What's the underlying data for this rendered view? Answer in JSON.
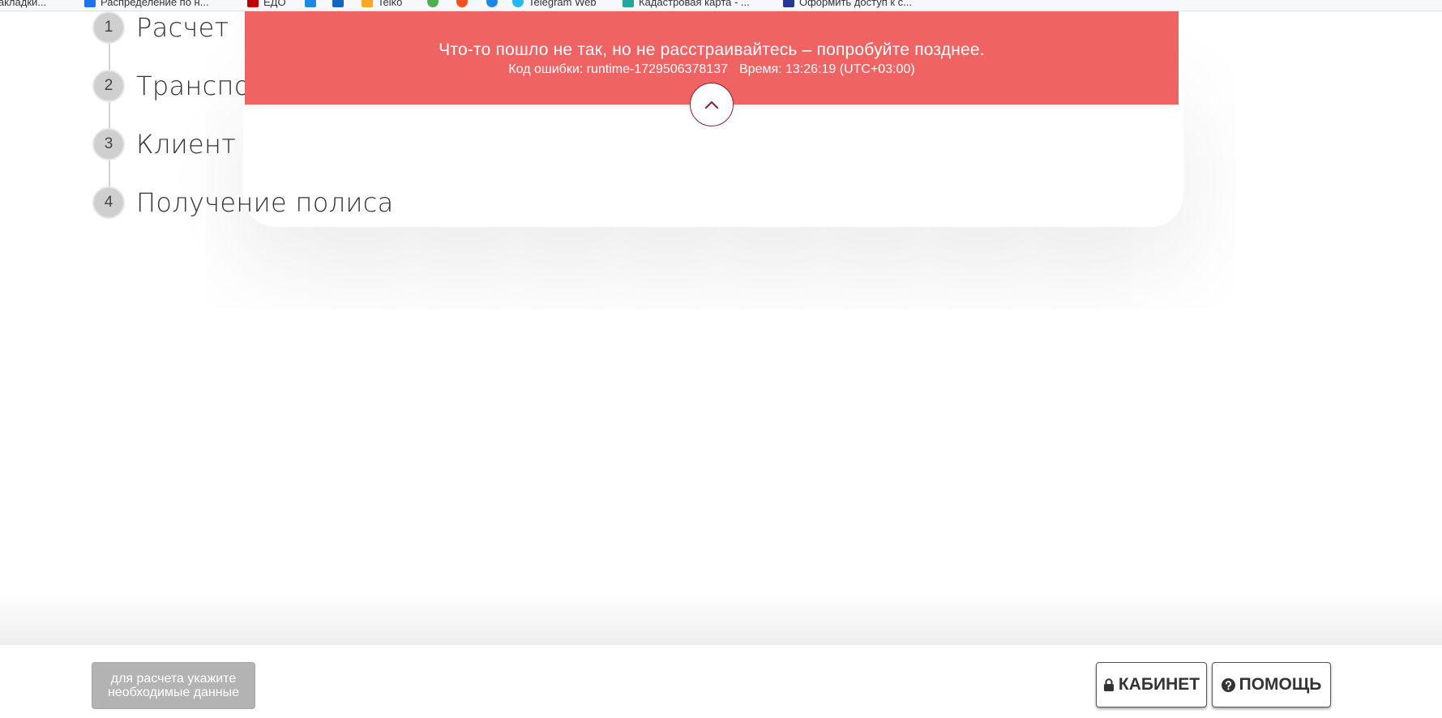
{
  "bookmarks": [
    {
      "label": "Закладки...",
      "color": "#1a73e8"
    },
    {
      "label": "Распределение по н...",
      "color": "#1a73e8"
    },
    {
      "label": "ЕДО",
      "color": "#c00000"
    },
    {
      "label": "",
      "color": "#1e88e5"
    },
    {
      "label": "",
      "color": "#1565c0"
    },
    {
      "label": "Telko",
      "color": "#f9a825"
    },
    {
      "label": "",
      "color": "#4caf50"
    },
    {
      "label": "",
      "color": "#f4511e"
    },
    {
      "label": "",
      "color": "#1e88e5"
    },
    {
      "label": "Telegram Web",
      "color": "#29b6f6"
    },
    {
      "label": "Кадастровая карта - ...",
      "color": "#26a69a"
    },
    {
      "label": "Оформить доступ к с...",
      "color": "#283593"
    }
  ],
  "steps": [
    {
      "number": "1",
      "label": "Расчет"
    },
    {
      "number": "2",
      "label": "Транспор"
    },
    {
      "number": "3",
      "label": "Клиент"
    },
    {
      "number": "4",
      "label": "Получение полиса"
    }
  ],
  "error": {
    "title": "Что-то пошло не так, но не расстраивайтесь – попробуйте позднее.",
    "code": "Код ошибки: runtime-1729506378137",
    "time": "Время: 13:26:19 (UTC+03:00)",
    "color": "#f06363",
    "collapse_icon": "chevron-up-icon"
  },
  "footer": {
    "calc_line1": "для расчета укажите",
    "calc_line2": "необходимые данные",
    "cabinet_label": "КАБИНЕТ",
    "cabinet_icon": "lock-icon",
    "help_label": "ПОМОЩЬ",
    "help_icon": "question-circle-icon"
  }
}
